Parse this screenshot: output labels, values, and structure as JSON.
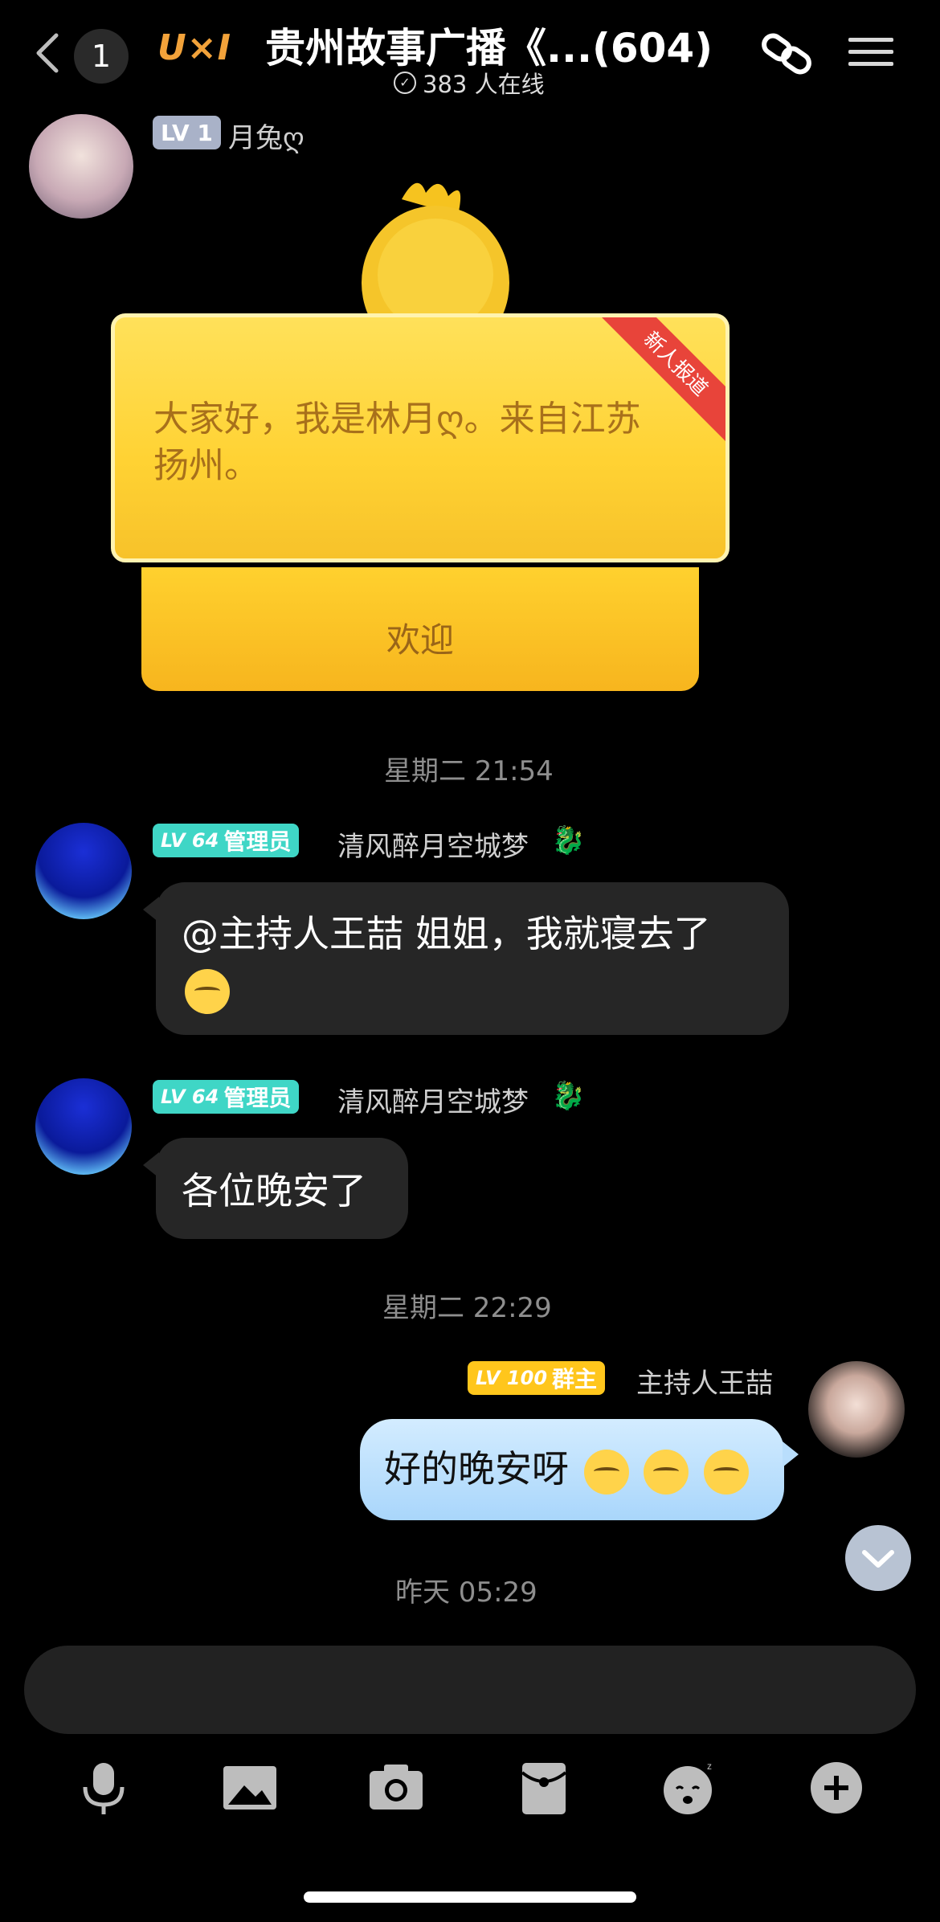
{
  "header": {
    "unread_count": "1",
    "logo_text": "U×I",
    "title": "贵州故事广播《...(604)",
    "online_text": "383 人在线"
  },
  "messages": {
    "intro": {
      "level": "LV 1",
      "username": "月兔ღ",
      "card_text": "大家好，我是林月ღ。来自江苏扬州。",
      "ribbon": "新人报道",
      "button": "欢迎"
    },
    "time1": "星期二 21:54",
    "msg1": {
      "level": "LV 64",
      "role": "管理员",
      "username": "清风醉月空城梦",
      "text": "@主持人王喆 姐姐，我就寝去了"
    },
    "msg2": {
      "level": "LV 64",
      "role": "管理员",
      "username": "清风醉月空城梦",
      "text": "各位晚安了"
    },
    "time2": "星期二 22:29",
    "msg3": {
      "level": "LV 100",
      "role": "群主",
      "username": "主持人王喆",
      "text": "好的晚安呀"
    },
    "time3": "昨天 05:29"
  },
  "colors": {
    "admin_badge": "#3fd6c6",
    "owner_badge": "#ffc61c",
    "lv1_badge": "#a9b2c8"
  },
  "toolbar": [
    "mic-icon",
    "image-icon",
    "camera-icon",
    "red-packet-icon",
    "sticker-icon",
    "plus-icon"
  ]
}
